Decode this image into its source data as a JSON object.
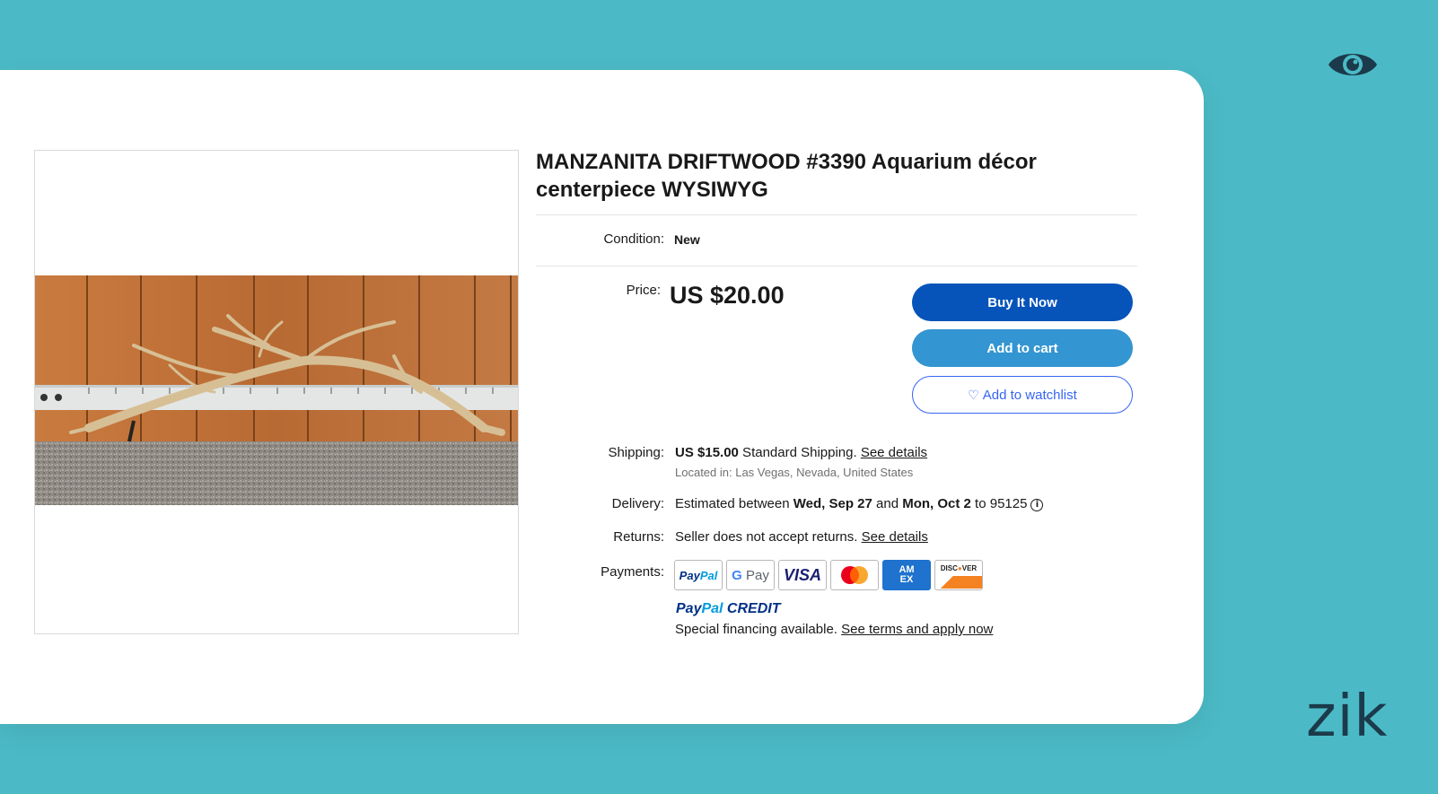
{
  "listing": {
    "title": "MANZANITA DRIFTWOOD #3390 Aquarium décor centerpiece WYSIWYG",
    "condition_label": "Condition:",
    "condition_value": "New",
    "price_label": "Price:",
    "price_value": "US $20.00",
    "buy_now_label": "Buy It Now",
    "add_to_cart_label": "Add to cart",
    "watchlist_label": "Add to watchlist",
    "shipping_label": "Shipping:",
    "shipping_price": "US $15.00",
    "shipping_method": " Standard Shipping. ",
    "shipping_link": "See details",
    "location": "Located in: Las Vegas, Nevada, United States",
    "delivery_label": "Delivery:",
    "delivery_prefix": "Estimated between ",
    "delivery_start": "Wed, Sep 27",
    "delivery_and": " and ",
    "delivery_end": "Mon, Oct 2",
    "delivery_suffix": " to 95125",
    "returns_label": "Returns:",
    "returns_text": "Seller does not accept returns. ",
    "returns_link": "See details",
    "payments_label": "Payments:",
    "payment_methods": [
      "PayPal",
      "G Pay",
      "VISA",
      "Mastercard",
      "AMEX",
      "DISCOVER"
    ],
    "paypal_credit_word1": "Pay",
    "paypal_credit_word2": "Pal",
    "paypal_credit_word3": " CREDIT",
    "financing_text": "Special financing available. ",
    "financing_link": "See terms and apply now"
  },
  "brand": {
    "logo_text": "zik"
  },
  "colors": {
    "background": "#4bbac6",
    "buy_now": "#0654ba",
    "add_to_cart": "#3395d1",
    "watchlist_outline": "#3665f3",
    "brand_dark": "#1b3a4b"
  }
}
